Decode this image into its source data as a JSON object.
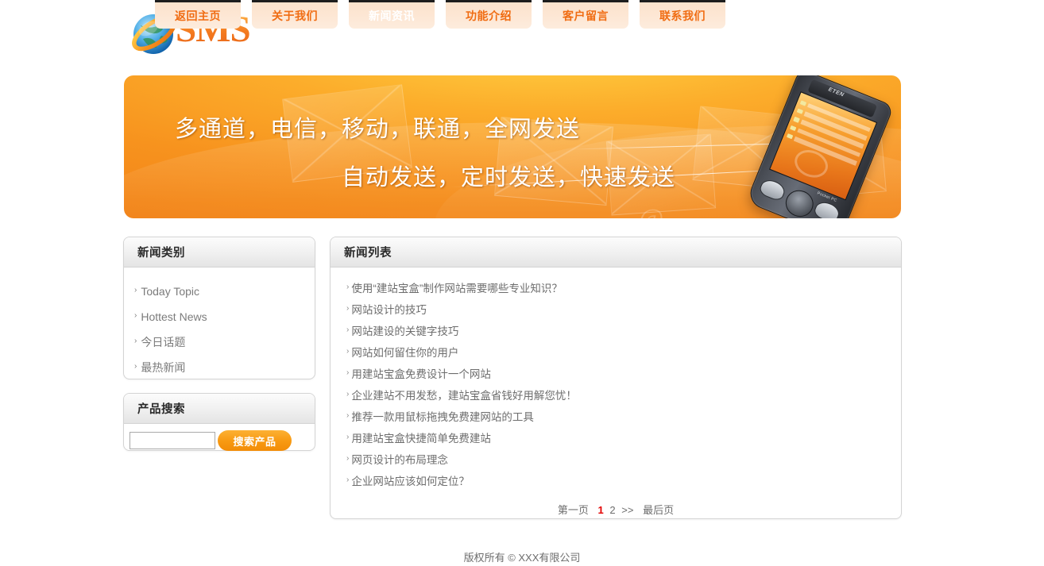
{
  "site": {
    "logo_text": "SMS",
    "logo_icon": "globe-icon"
  },
  "nav": {
    "items": [
      {
        "label": "返回主页",
        "active": false
      },
      {
        "label": "关于我们",
        "active": false
      },
      {
        "label": "新闻资讯",
        "active": true
      },
      {
        "label": "功能介绍",
        "active": false
      },
      {
        "label": "客户留言",
        "active": false
      },
      {
        "label": "联系我们",
        "active": false
      }
    ]
  },
  "banner": {
    "line1": "多通道，电信，移动，联通，全网发送",
    "line2": "自动发送，定时发送，快速发送",
    "phone_brand": "ETEN",
    "phone_label": "Pocket PC",
    "at_symbol": "@",
    "colors": {
      "bg_start": "#ffd142",
      "bg_mid": "#f7931e",
      "bg_end": "#f07d15"
    }
  },
  "sidebar": {
    "category_card": {
      "title": "新闻类别",
      "items": [
        {
          "label": "Today Topic"
        },
        {
          "label": "Hottest News"
        },
        {
          "label": "今日话题"
        },
        {
          "label": "最热新闻"
        }
      ]
    },
    "search_card": {
      "title": "产品搜索",
      "input_value": "",
      "input_placeholder": "",
      "button_label": "搜索产品"
    }
  },
  "news": {
    "title": "新闻列表",
    "items": [
      {
        "label": "使用“建站宝盒”制作网站需要哪些专业知识？"
      },
      {
        "label": "网站设计的技巧"
      },
      {
        "label": "网站建设的关键字技巧"
      },
      {
        "label": "网站如何留住你的用户"
      },
      {
        "label": "用建站宝盒免费设计一个网站"
      },
      {
        "label": "企业建站不用发愁，建站宝盒省钱好用解您忧！"
      },
      {
        "label": "推荐一款用鼠标拖拽免费建网站的工具"
      },
      {
        "label": "用建站宝盒快捷简单免费建站"
      },
      {
        "label": "网页设计的布局理念"
      },
      {
        "label": "企业网站应该如何定位？"
      }
    ],
    "pager": {
      "first": "第一页",
      "page1": "1",
      "page2": "2",
      "next": ">>",
      "last": "最后页",
      "current_color": "#e30000"
    }
  },
  "footer": {
    "copyright": "版权所有 © XXX有限公司"
  },
  "icons": {
    "chevron": "›"
  }
}
